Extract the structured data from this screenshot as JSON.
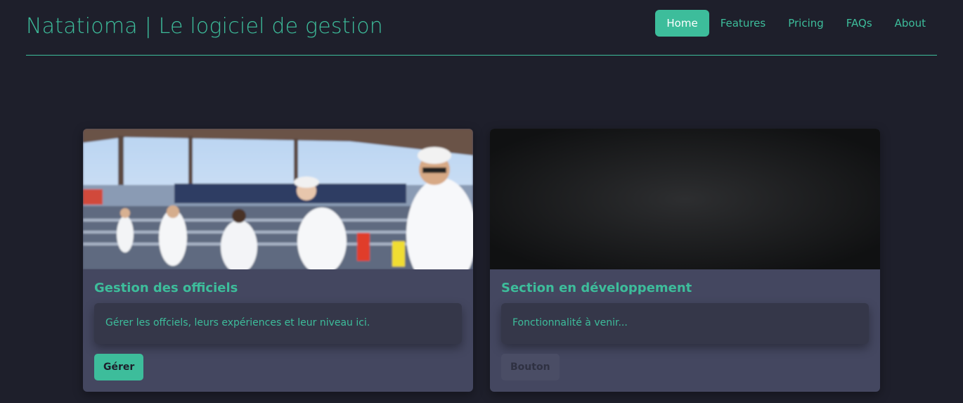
{
  "header": {
    "brand": "Natatioma | Le logiciel de gestion",
    "nav": [
      {
        "label": "Home",
        "active": true
      },
      {
        "label": "Features"
      },
      {
        "label": "Pricing"
      },
      {
        "label": "FAQs"
      },
      {
        "label": "About"
      }
    ]
  },
  "cards": [
    {
      "title": "Gestion des officiels",
      "text": "Gérer les offciels, leurs expériences et leur niveau ici.",
      "button": "Gérer"
    },
    {
      "title": "Section en développement",
      "text": "Fonctionnalité à venir...",
      "button": "Bouton"
    }
  ],
  "colors": {
    "accent": "#3dbd9b",
    "background": "#1e1f2b",
    "card": "#444760"
  }
}
